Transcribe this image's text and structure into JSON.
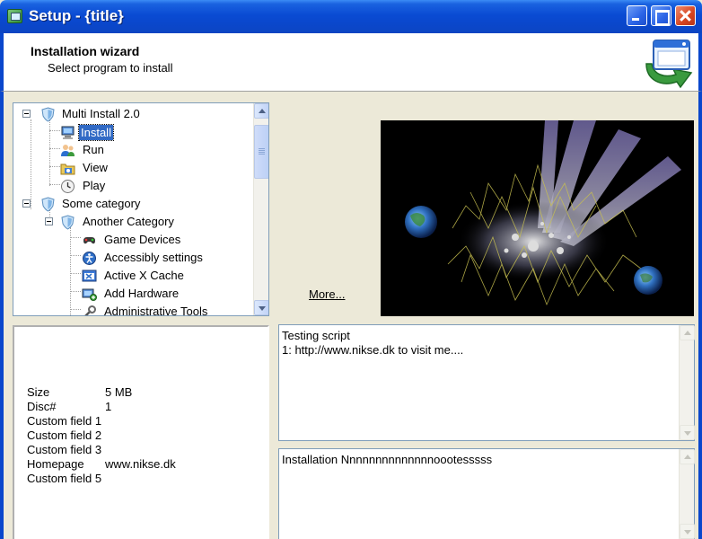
{
  "window": {
    "title": "Setup - {title}",
    "minimize_icon": "minimize-icon",
    "maximize_icon": "maximize-icon",
    "close_icon": "close-icon"
  },
  "header": {
    "title": "Installation wizard",
    "subtitle": "Select program to install",
    "icon": "install-wizard-icon"
  },
  "tree": {
    "items": [
      {
        "label": "Multi Install 2.0",
        "icon": "shield-icon",
        "level": 0,
        "expander": true
      },
      {
        "label": "Install",
        "icon": "computer-icon",
        "level": 1,
        "selected": true
      },
      {
        "label": "Run",
        "icon": "users-icon",
        "level": 1
      },
      {
        "label": "View",
        "icon": "folder-view-icon",
        "level": 1
      },
      {
        "label": "Play",
        "icon": "clock-icon",
        "level": 1
      },
      {
        "label": "Some category",
        "icon": "shield-icon",
        "level": 0,
        "expander": true
      },
      {
        "label": "Another Category",
        "icon": "shield-icon",
        "level": 1,
        "expander": true
      },
      {
        "label": "Game Devices",
        "icon": "game-controller-icon",
        "level": 2
      },
      {
        "label": "Accessibly settings",
        "icon": "accessibility-icon",
        "level": 2
      },
      {
        "label": "Active X Cache",
        "icon": "activex-icon",
        "level": 2
      },
      {
        "label": "Add Hardware",
        "icon": "hardware-icon",
        "level": 2
      },
      {
        "label": "Administrative Tools",
        "icon": "admin-tools-icon",
        "level": 2
      }
    ]
  },
  "preview": {
    "more_label": "More..."
  },
  "info": {
    "rows": [
      {
        "key": "Size",
        "value": "5 MB"
      },
      {
        "key": "Disc#",
        "value": "1"
      },
      {
        "key": "Custom field 1",
        "value": ""
      },
      {
        "key": "Custom field 2",
        "value": ""
      },
      {
        "key": "Custom field 3",
        "value": ""
      },
      {
        "key": "Homepage",
        "value": "www.nikse.dk"
      },
      {
        "key": "Custom field 5",
        "value": ""
      }
    ]
  },
  "script_box": {
    "text": "Testing script\n1: http://www.nikse.dk to visit me...."
  },
  "notes_box": {
    "text": "Installation Nnnnnnnnnnnnnnoootesssss"
  },
  "colors": {
    "titlebar": "#0a47cc",
    "selection": "#316ac5",
    "window_bg": "#ece9d8"
  }
}
